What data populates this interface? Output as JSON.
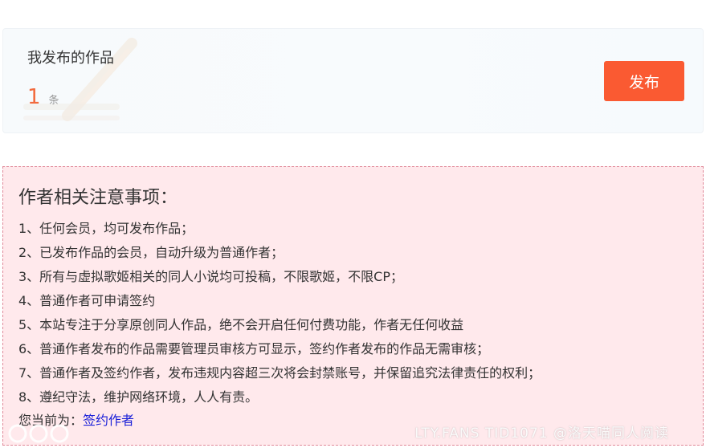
{
  "works_card": {
    "title": "我发布的作品",
    "count": "1",
    "count_unit": "条",
    "publish_button_label": "发布"
  },
  "notice": {
    "title": "作者相关注意事项：",
    "items": [
      "1、任何会员，均可发布作品；",
      "2、已发布作品的会员，自动升级为普通作者；",
      "3、所有与虚拟歌姬相关的同人小说均可投稿，不限歌姬，不限CP；",
      "4、普通作者可申请签约",
      "5、本站专注于分享原创同人作品，绝不会开启任何付费功能，作者无任何收益",
      "6、普通作者发布的作品需要管理员审核方可显示，签约作者发布的作品无需审核；",
      "7、普通作者及签约作者，发布违规内容超三次将会封禁账号，并保留追究法律责任的权利；",
      "8、遵纪守法，维护网络环境，人人有责。"
    ],
    "role_prefix": "您当前为：",
    "role_value": "签约作者"
  },
  "watermark": {
    "text": "LTY.FANS TID1071 @洛天喵同人阅读"
  },
  "colors": {
    "accent_orange": "#fa5a32",
    "count_orange": "#f26a3d",
    "notice_bg": "#ffe9ec",
    "notice_border": "#e08a9a",
    "link_blue": "#1a20d8"
  }
}
